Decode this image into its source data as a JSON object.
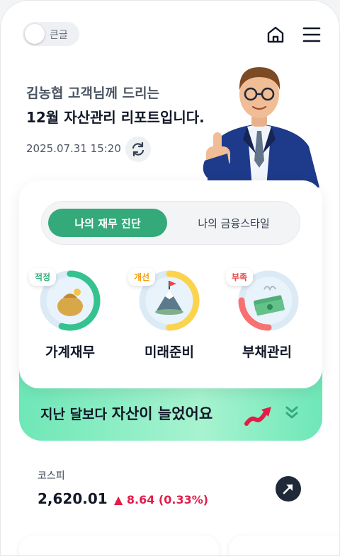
{
  "header": {
    "toggle_label": "큰글",
    "home_icon": "home-icon",
    "menu_icon": "hamburger-menu-icon"
  },
  "greeting": {
    "line1": "김농협 고객님께 드리는",
    "line2": "12월 자산관리 리포트입니다.",
    "datetime": "2025.07.31 15:20",
    "refresh_icon": "refresh-icon"
  },
  "tabs": [
    {
      "label": "나의 재무 진단",
      "active": true
    },
    {
      "label": "나의 금융스타일",
      "active": false
    }
  ],
  "diagnosis": [
    {
      "badge": "적정",
      "label": "가계재무",
      "badge_color": "#34b27d",
      "ring_color": "#34c38f",
      "level": 0.55,
      "icon": "money-bag-icon"
    },
    {
      "badge": "개선",
      "label": "미래준비",
      "badge_color": "#f59e0b",
      "ring_color": "#fcd34d",
      "level": 0.5,
      "icon": "mountain-flag-icon"
    },
    {
      "badge": "부족",
      "label": "부채관리",
      "badge_color": "#ef4444",
      "ring_color": "#f87171",
      "level": 0.25,
      "icon": "cash-stack-icon"
    }
  ],
  "summary": {
    "text_plain": "지난 달보다 ",
    "text_strong": "자산이 늘었어요",
    "trend_icon": "trend-up-arrow-icon",
    "expand_icon": "double-chevron-down-icon"
  },
  "market": {
    "label": "코스피",
    "value": "2,620.01",
    "change": "▲ 8.64 (0.33%)",
    "change_color": "#e11d48",
    "link_icon": "arrow-up-right-icon"
  },
  "colors": {
    "accent_green": "#34a97a",
    "banner_green": "#6ee7b7"
  }
}
